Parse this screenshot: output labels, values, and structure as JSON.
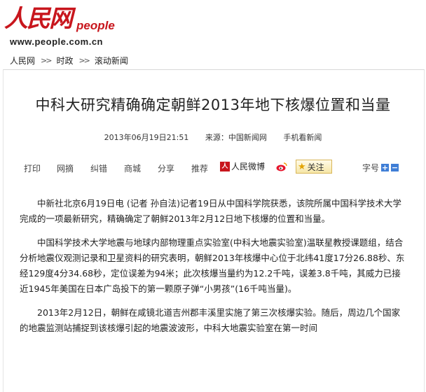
{
  "logo": {
    "cn": "人民网",
    "en": "people",
    "url": "www.people.com.cn"
  },
  "breadcrumb": [
    "人民网",
    "时政",
    "滚动新闻"
  ],
  "breadcrumb_sep": ">>",
  "article": {
    "title": "中科大研究精确确定朝鲜2013年地下核爆位置和当量",
    "datetime": "2013年06月19日21:51",
    "source": "来源：中国新闻网",
    "mobile": "手机看新闻",
    "paragraphs": [
      "中新社北京6月19日电 (记者 孙自法)记者19日从中国科学院获悉，该院所属中国科学技术大学完成的一项最新研究，精确确定了朝鲜2013年2月12日地下核爆的位置和当量。",
      "中国科学技术大学地震与地球内部物理重点实验室(中科大地震实验室)温联星教授课题组，结合分析地震仪观测记录和卫星资料的研究表明，朝鲜2013年核爆中心位于北纬41度17分26.88秒、东经129度4分34.68秒，定位误差为94米；此次核爆当量约为12.2千吨，误差3.8千吨，其威力已接近1945年美国在日本广岛投下的第一颗原子弹“小男孩”(16千吨当量)。",
      "2013年2月12日，朝鲜在咸镜北道吉州郡丰溪里实施了第三次核爆实验。随后，周边几个国家的地震监测站捕捉到该核爆引起的地震波波形，中科大地震实验室在第一时间"
    ]
  },
  "tools": {
    "print": "打印",
    "web_review": "网摘",
    "correction": "纠错",
    "shop": "商城",
    "share": "分享",
    "recommend": "推荐",
    "weibo": "人民微博",
    "follow": "关注",
    "font_size": "字号"
  }
}
